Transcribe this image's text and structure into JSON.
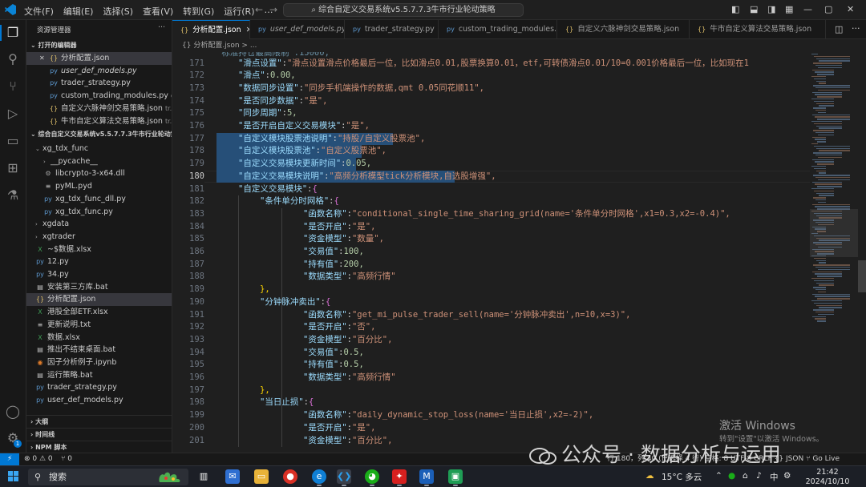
{
  "titlebar": {
    "menu": [
      "文件(F)",
      "编辑(E)",
      "选择(S)",
      "查看(V)",
      "转到(G)",
      "运行(R)",
      "…"
    ],
    "command_center": "综合自定义交易系统v5.5.7.7.3牛市行业轮动策略",
    "back_arrow": "←",
    "forward_arrow": "→"
  },
  "activity_bar": {
    "icons": [
      "explorer-icon",
      "search-icon",
      "source-control-icon",
      "run-debug-icon",
      "remote-explorer-icon",
      "extensions-icon",
      "testing-icon",
      "account-icon",
      "settings-icon"
    ],
    "settings_badge": "1"
  },
  "sidebar": {
    "title": "资源管理器",
    "more": "···",
    "open_editors_header": "打开的编辑器",
    "open_editors": [
      {
        "name": "分析配置.json",
        "type": "json",
        "desc": "",
        "close": "✕"
      },
      {
        "name": "user_def_models.py",
        "type": "py",
        "desc": ""
      },
      {
        "name": "trader_strategy.py",
        "type": "py",
        "desc": ""
      },
      {
        "name": "custom_trading_modules.py",
        "type": "py",
        "desc": "cus..."
      },
      {
        "name": "自定义六脉神剑交易策略.json",
        "type": "json",
        "desc": "tr..."
      },
      {
        "name": "牛市自定义算法交易策略.json",
        "type": "json",
        "desc": "tr..."
      }
    ],
    "folder_header": "综合自定义交易系统v5.5.7.7.3牛市行业轮动策...",
    "tree": [
      {
        "name": "xg_tdx_func",
        "kind": "folder-open",
        "indent": 1
      },
      {
        "name": "__pycache__",
        "kind": "folder",
        "indent": 2
      },
      {
        "name": "libcrypto-3-x64.dll",
        "kind": "dll",
        "indent": 2
      },
      {
        "name": "pyML.pyd",
        "kind": "pyd",
        "indent": 2
      },
      {
        "name": "xg_tdx_func_dll.py",
        "kind": "py",
        "indent": 2
      },
      {
        "name": "xg_tdx_func.py",
        "kind": "py",
        "indent": 2
      },
      {
        "name": "xgdata",
        "kind": "folder",
        "indent": 1
      },
      {
        "name": "xgtrader",
        "kind": "folder",
        "indent": 1
      },
      {
        "name": "~$数据.xlsx",
        "kind": "xls",
        "indent": 1
      },
      {
        "name": "12.py",
        "kind": "py",
        "indent": 1
      },
      {
        "name": "34.py",
        "kind": "py",
        "indent": 1
      },
      {
        "name": "安装第三方库.bat",
        "kind": "bat",
        "indent": 1
      },
      {
        "name": "分析配置.json",
        "kind": "json",
        "indent": 1,
        "selected": true
      },
      {
        "name": "港股全部ETF.xlsx",
        "kind": "xls",
        "indent": 1
      },
      {
        "name": "更新说明.txt",
        "kind": "txt",
        "indent": 1
      },
      {
        "name": "数据.xlsx",
        "kind": "xls",
        "indent": 1
      },
      {
        "name": "推出不结束桌面.bat",
        "kind": "bat",
        "indent": 1
      },
      {
        "name": "因子分析例子.ipynb",
        "kind": "nb",
        "indent": 1
      },
      {
        "name": "运行策略.bat",
        "kind": "bat",
        "indent": 1
      },
      {
        "name": "trader_strategy.py",
        "kind": "py",
        "indent": 1
      },
      {
        "name": "user_def_models.py",
        "kind": "py",
        "indent": 1
      }
    ],
    "bottom_sections": [
      "大纲",
      "时间线",
      "NPM 脚本"
    ]
  },
  "tabs": [
    {
      "label": "分析配置.json",
      "type": "json",
      "active": true
    },
    {
      "label": "user_def_models.py",
      "type": "py"
    },
    {
      "label": "trader_strategy.py",
      "type": "py"
    },
    {
      "label": "custom_trading_modules.py",
      "type": "py"
    },
    {
      "label": "自定义六脉神剑交易策略.json",
      "type": "json"
    },
    {
      "label": "牛市自定义算法交易策略.json",
      "type": "json"
    }
  ],
  "breadcrumb": "{} 分析配置.json > ...",
  "editor": {
    "partial_top_line": "\"标准持仓最高限制\":15000,",
    "lines": [
      {
        "n": "171",
        "indent": 1,
        "key": "\"滑点设置\"",
        "val": "\"滑点设置滑点价格最后一位，比如滑点0.01,股票换算0.01，etf,可转债滑点0.01/10=0.001价格最后一位，比如现在1"
      },
      {
        "n": "172",
        "indent": 1,
        "key": "\"滑点\"",
        "val": "0.00,"
      },
      {
        "n": "173",
        "indent": 1,
        "key": "\"数据同步设置\"",
        "val": "\"同步手机端操作的数据,qmt 0.05同花顺11\","
      },
      {
        "n": "174",
        "indent": 1,
        "key": "\"是否同步数据\"",
        "val": "\"是\","
      },
      {
        "n": "175",
        "indent": 1,
        "key": "\"同步周期\"",
        "val": "5,"
      },
      {
        "n": "176",
        "indent": 1,
        "key": "\"是否开启自定义交易模块\"",
        "val": "\"是\","
      },
      {
        "n": "177",
        "indent": 1,
        "key": "\"自定义模块股票池说明\"",
        "val": "\"持股/自定义股票池\",",
        "sel": true
      },
      {
        "n": "178",
        "indent": 1,
        "key": "\"自定义模块股票池\"",
        "val": "\"自定义股票池\",",
        "sel": true
      },
      {
        "n": "179",
        "indent": 1,
        "key": "\"自定义交易模块更新时间\"",
        "val": "0.05,",
        "sel": true
      },
      {
        "n": "180",
        "indent": 1,
        "key": "\"自定义交易模块说明\"",
        "val": "\"高频分析模型tick分析模块,自选股增强\",",
        "sel": true,
        "current": true
      },
      {
        "n": "181",
        "indent": 1,
        "key": "\"自定义交易模块\"",
        "val": "{"
      },
      {
        "n": "182",
        "indent": 2,
        "key": "\"条件单分时网格\"",
        "val": "{"
      },
      {
        "n": "183",
        "indent": 4,
        "key": "\"函数名称\"",
        "val": "\"conditional_single_time_sharing_grid(name='条件单分时网格',x1=0.3,x2=-0.4)\","
      },
      {
        "n": "184",
        "indent": 4,
        "key": "\"是否开启\"",
        "val": "\"是\","
      },
      {
        "n": "185",
        "indent": 4,
        "key": "\"资金模型\"",
        "val": "\"数量\","
      },
      {
        "n": "186",
        "indent": 4,
        "key": "\"交易值\"",
        "val": "100,"
      },
      {
        "n": "187",
        "indent": 4,
        "key": "\"持有值\"",
        "val": "200,"
      },
      {
        "n": "188",
        "indent": 4,
        "key": "\"数据类型\"",
        "val": "\"高频行情\""
      },
      {
        "n": "189",
        "indent": 2,
        "key": "",
        "val": "},"
      },
      {
        "n": "190",
        "indent": 2,
        "key": "\"分钟脉冲卖出\"",
        "val": "{"
      },
      {
        "n": "191",
        "indent": 4,
        "key": "\"函数名称\"",
        "val": "\"get_mi_pulse_trader_sell(name='分钟脉冲卖出',n=10,x=3)\","
      },
      {
        "n": "192",
        "indent": 4,
        "key": "\"是否开启\"",
        "val": "\"否\","
      },
      {
        "n": "193",
        "indent": 4,
        "key": "\"资金模型\"",
        "val": "\"百分比\","
      },
      {
        "n": "194",
        "indent": 4,
        "key": "\"交易值\"",
        "val": "0.5,"
      },
      {
        "n": "195",
        "indent": 4,
        "key": "\"持有值\"",
        "val": "0.5,"
      },
      {
        "n": "196",
        "indent": 4,
        "key": "\"数据类型\"",
        "val": "\"高频行情\""
      },
      {
        "n": "197",
        "indent": 2,
        "key": "",
        "val": "},"
      },
      {
        "n": "198",
        "indent": 2,
        "key": "\"当日止损\"",
        "val": "{"
      },
      {
        "n": "199",
        "indent": 4,
        "key": "\"函数名称\"",
        "val": "\"daily_dynamic_stop_loss(name='当日止损',x2=-2)\","
      },
      {
        "n": "200",
        "indent": 4,
        "key": "\"是否开启\"",
        "val": "\"是\","
      },
      {
        "n": "201",
        "indent": 4,
        "key": "\"资金模型\"",
        "val": "\"百分比\","
      }
    ]
  },
  "activation_watermark": {
    "line1": "激活 Windows",
    "line2": "转到\"设置\"以激活 Windows。"
  },
  "wechat_watermark": "公众号 · 数据分析与运用",
  "statusbar": {
    "remote": "⚡",
    "errors": "⊗ 0 ⚠ 0",
    "ports": "⑂ 0",
    "right": "行 180，列 40 (已选择 4 行)  空格: 8  UTF-8  CRLF  {} JSON  ⑂ Go Live"
  },
  "taskbar": {
    "search_placeholder": "搜索",
    "weather": "15°C 多云",
    "ime": "中",
    "time": "21:42",
    "date": "2024/10/10"
  },
  "colors": {
    "accent": "#0078d4",
    "selection": "#264f78",
    "string": "#ce9178",
    "key": "#9cdcfe",
    "number": "#b5cea8"
  }
}
